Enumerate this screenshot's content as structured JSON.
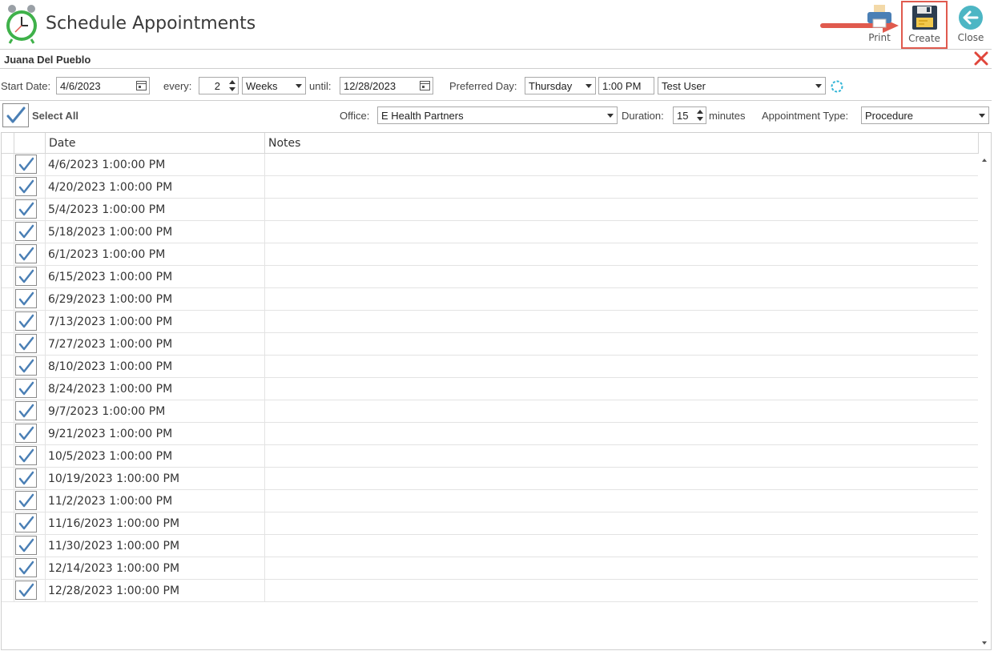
{
  "header": {
    "title": "Schedule Appointments",
    "app_icon": "alarm-clock-icon",
    "toolbar": {
      "print_label": "Print",
      "create_label": "Create",
      "close_label": "Close"
    }
  },
  "patient": {
    "name": "Juana Del Pueblo"
  },
  "recurrence": {
    "start_date_label": "Start Date:",
    "start_date": "4/6/2023",
    "every_label": "every:",
    "every_value": "2",
    "period": "Weeks",
    "until_label": "until:",
    "until_date": "12/28/2023",
    "preferred_day_label": "Preferred Day:",
    "preferred_day": "Thursday",
    "time": "1:00 PM",
    "user": "Test User"
  },
  "options": {
    "select_all_label": "Select All",
    "office_label": "Office:",
    "office": "E Health Partners",
    "duration_label": "Duration:",
    "duration": "15",
    "minutes_label": "minutes",
    "appointment_type_label": "Appointment Type:",
    "appointment_type": "Procedure"
  },
  "grid": {
    "columns": [
      "Date",
      "Notes"
    ],
    "rows": [
      {
        "date": "4/6/2023 1:00:00 PM",
        "notes": "",
        "checked": true
      },
      {
        "date": "4/20/2023 1:00:00 PM",
        "notes": "",
        "checked": true
      },
      {
        "date": "5/4/2023 1:00:00 PM",
        "notes": "",
        "checked": true
      },
      {
        "date": "5/18/2023 1:00:00 PM",
        "notes": "",
        "checked": true
      },
      {
        "date": "6/1/2023 1:00:00 PM",
        "notes": "",
        "checked": true
      },
      {
        "date": "6/15/2023 1:00:00 PM",
        "notes": "",
        "checked": true
      },
      {
        "date": "6/29/2023 1:00:00 PM",
        "notes": "",
        "checked": true
      },
      {
        "date": "7/13/2023 1:00:00 PM",
        "notes": "",
        "checked": true
      },
      {
        "date": "7/27/2023 1:00:00 PM",
        "notes": "",
        "checked": true
      },
      {
        "date": "8/10/2023 1:00:00 PM",
        "notes": "",
        "checked": true
      },
      {
        "date": "8/24/2023 1:00:00 PM",
        "notes": "",
        "checked": true
      },
      {
        "date": "9/7/2023 1:00:00 PM",
        "notes": "",
        "checked": true
      },
      {
        "date": "9/21/2023 1:00:00 PM",
        "notes": "",
        "checked": true
      },
      {
        "date": "10/5/2023 1:00:00 PM",
        "notes": "",
        "checked": true
      },
      {
        "date": "10/19/2023 1:00:00 PM",
        "notes": "",
        "checked": true
      },
      {
        "date": "11/2/2023 1:00:00 PM",
        "notes": "",
        "checked": true
      },
      {
        "date": "11/16/2023 1:00:00 PM",
        "notes": "",
        "checked": true
      },
      {
        "date": "11/30/2023 1:00:00 PM",
        "notes": "",
        "checked": true
      },
      {
        "date": "12/14/2023 1:00:00 PM",
        "notes": "",
        "checked": true
      },
      {
        "date": "12/28/2023 1:00:00 PM",
        "notes": "",
        "checked": true
      }
    ]
  },
  "colors": {
    "accent_blue": "#4a7fb5",
    "highlight_red": "#e05a4e",
    "close_teal": "#4db6c4",
    "border_gray": "#cfcfcf"
  }
}
